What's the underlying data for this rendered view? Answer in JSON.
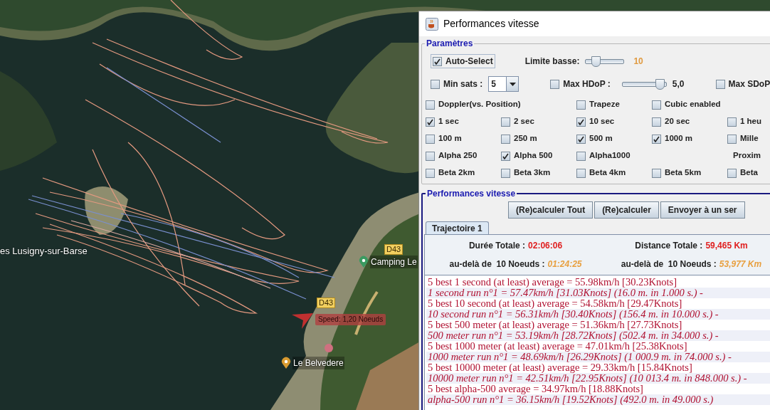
{
  "map": {
    "labels": [
      {
        "kind": "place",
        "text": "es Lusigny-sur-Barse"
      },
      {
        "kind": "road",
        "text": "D43"
      },
      {
        "kind": "camping",
        "text": "Camping Le"
      },
      {
        "kind": "road",
        "text": "D43"
      },
      {
        "kind": "restaurant",
        "text": "Le Belvedere"
      }
    ],
    "speed_label": "Speed: 1,20 Noeuds"
  },
  "window": {
    "title": "Performances vitesse",
    "parametres": {
      "title": "Paramètres",
      "auto_select": {
        "label": "Auto-Select",
        "checked": true
      },
      "limite_basse": {
        "label": "Limite basse:",
        "level": 0.25,
        "value": "10"
      },
      "min_sats": {
        "label": "Min sats :",
        "checked": false,
        "value": "5"
      },
      "max_hdop": {
        "label": "Max HDoP :",
        "checked": false,
        "level": 0.85,
        "value": "5,0"
      },
      "max_sdop": {
        "label": "Max SDoP",
        "checked": false
      },
      "rows": [
        [
          {
            "kind": "checkbox",
            "label": "Doppler(vs. Position)",
            "checked": false
          },
          {
            "kind": "spacer"
          },
          {
            "kind": "checkbox",
            "label": "Trapeze",
            "checked": false
          },
          {
            "kind": "checkbox",
            "label": "Cubic enabled",
            "checked": false
          }
        ],
        [
          {
            "kind": "checkbox",
            "label": "1 sec",
            "checked": true
          },
          {
            "kind": "checkbox",
            "label": "2 sec",
            "checked": false
          },
          {
            "kind": "checkbox",
            "label": "10 sec",
            "checked": true
          },
          {
            "kind": "checkbox",
            "label": "20 sec",
            "checked": false
          },
          {
            "kind": "checkbox",
            "label": "1 heu",
            "checked": false
          }
        ],
        [
          {
            "kind": "checkbox",
            "label": "100 m",
            "checked": false
          },
          {
            "kind": "checkbox",
            "label": "250 m",
            "checked": false
          },
          {
            "kind": "checkbox",
            "label": "500 m",
            "checked": true
          },
          {
            "kind": "checkbox",
            "label": "1000 m",
            "checked": true
          },
          {
            "kind": "checkbox",
            "label": "Mille",
            "checked": false
          }
        ],
        [
          {
            "kind": "checkbox",
            "label": "Alpha 250",
            "checked": false
          },
          {
            "kind": "checkbox",
            "label": "Alpha 500",
            "checked": true
          },
          {
            "kind": "checkbox",
            "label": "Alpha1000",
            "checked": false
          },
          {
            "kind": "spacer"
          },
          {
            "kind": "text",
            "label": "Proxim"
          }
        ],
        [
          {
            "kind": "checkbox",
            "label": "Beta 2km",
            "checked": false
          },
          {
            "kind": "checkbox",
            "label": "Beta 3km",
            "checked": false
          },
          {
            "kind": "checkbox",
            "label": "Beta 4km",
            "checked": false
          },
          {
            "kind": "checkbox",
            "label": "Beta 5km",
            "checked": false
          },
          {
            "kind": "checkbox",
            "label": "Beta",
            "checked": false
          }
        ]
      ]
    },
    "performances": {
      "title": "Performances vitesse",
      "buttons": [
        "(Re)calculer Tout",
        "(Re)calculer",
        "Envoyer à un ser"
      ],
      "tabs": [
        {
          "label": "Trajectoire 1",
          "selected": true
        }
      ],
      "stats": [
        {
          "label": "Durée Totale :",
          "value": "02:06:06",
          "kind": "total"
        },
        {
          "label": "Distance Totale :",
          "value": "59,465 Km",
          "kind": "total"
        },
        {
          "label": "au-delà de  10 Noeuds :",
          "value": "01:24:25",
          "kind": "above"
        },
        {
          "label": "au-delà de  10 Noeuds :",
          "value": "53,977 Km",
          "kind": "above"
        }
      ],
      "results": [
        {
          "kind": "summary",
          "text": "5 best 1 second (at least) average = 55.98km/h [30.23Knots]"
        },
        {
          "kind": "run",
          "text": "1 second run n°1 = 57.47km/h [31.03Knots] (16.0 m. in 1.000 s.) -"
        },
        {
          "kind": "summary",
          "text": "5 best 10 second (at least) average = 54.58km/h [29.47Knots]"
        },
        {
          "kind": "run",
          "text": "10 second run n°1 = 56.31km/h [30.40Knots] (156.4 m. in 10.000 s.) -"
        },
        {
          "kind": "summary",
          "text": "5 best 500 meter (at least) average = 51.36km/h [27.73Knots]"
        },
        {
          "kind": "run",
          "text": "500 meter run n°1 = 53.19km/h [28.72Knots] (502.4 m. in 34.000 s.) -"
        },
        {
          "kind": "summary",
          "text": "5 best 1000 meter (at least) average = 47.01km/h [25.38Knots]"
        },
        {
          "kind": "run",
          "text": "1000 meter run n°1 = 48.69km/h [26.29Knots] (1 000.9 m. in 74.000 s.) -"
        },
        {
          "kind": "summary",
          "text": "5 best 10000 meter (at least) average = 29.33km/h [15.84Knots]"
        },
        {
          "kind": "run",
          "text": "10000 meter run n°1 = 42.51km/h [22.95Knots] (10 013.4 m. in 848.000 s.) -"
        },
        {
          "kind": "summary",
          "text": "5 best alpha-500 average = 34.97km/h [18.88Knots]"
        },
        {
          "kind": "run",
          "text": "alpha-500 run n°1 = 36.15km/h [19.52Knots] (492.0 m. in 49.000 s.)"
        }
      ]
    }
  }
}
